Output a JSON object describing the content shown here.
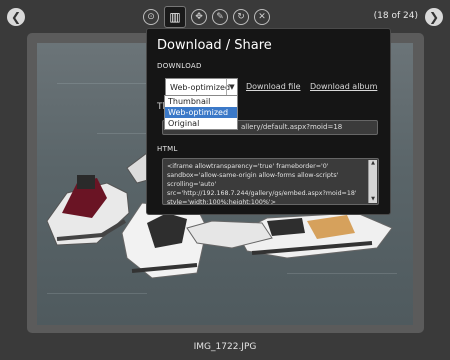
{
  "counter": "(18 of 24)",
  "nav": {
    "prev_icon": "left-arrow",
    "next_icon": "right-arrow"
  },
  "toolbar": {
    "tools": [
      "info-icon",
      "download-share-icon",
      "move-icon",
      "edit-icon",
      "rotate-icon",
      "delete-icon"
    ],
    "active": "download-share-icon"
  },
  "caption": "IMG_1722.JPG",
  "panel": {
    "title": "Download / Share",
    "download_label": "DOWNLOAD",
    "select_value": "Web-optimized",
    "options": [
      "Thumbnail",
      "Web-optimized",
      "Original"
    ],
    "selected_index": 1,
    "download_file": "Download file",
    "download_album": "Download album",
    "url_label_partial": "Th",
    "url_value": "allery/default.aspx?moid=18",
    "html_label": "HTML",
    "html_value": "<iframe allowtransparency='true' frameborder='0' sandbox='allow-same-origin allow-forms allow-scripts' scrolling='auto' src='http://192.168.7.244/gallery/gs/embed.aspx?moid=18' style='width:100%;height:100%'>"
  }
}
